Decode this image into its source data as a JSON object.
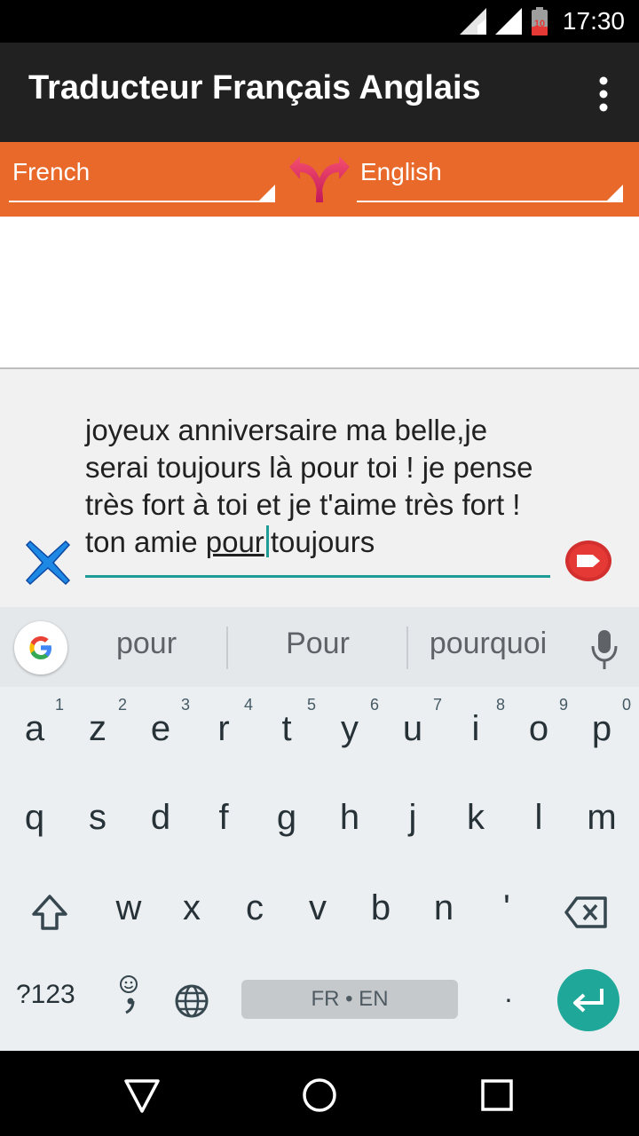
{
  "status_bar": {
    "time": "17:30",
    "battery_level": "10",
    "icons": [
      "signal-icon",
      "wifi-icon",
      "battery-icon"
    ]
  },
  "app_bar": {
    "title": "Traducteur Français Anglais",
    "overflow_icon": "more-vert-icon"
  },
  "language_bar": {
    "source_language": "French",
    "target_language": "English",
    "swap_icon": "swap-arrows-icon",
    "color": "#E8692A"
  },
  "input": {
    "text_before": "joyeux anniversaire ma belle,je serai toujours là pour toi ! je pense très fort à toi et je t'aime très fort ! ton amie ",
    "composing_word": "pour",
    "text_after": "toujours",
    "clear_icon": "clear-x-icon",
    "send_icon": "translate-send-icon",
    "accent_color": "#1E9C96"
  },
  "keyboard": {
    "suggestions": [
      "pour",
      "Pour",
      "pourquoi"
    ],
    "row1": [
      {
        "key": "a",
        "hint": "1"
      },
      {
        "key": "z",
        "hint": "2"
      },
      {
        "key": "e",
        "hint": "3"
      },
      {
        "key": "r",
        "hint": "4"
      },
      {
        "key": "t",
        "hint": "5"
      },
      {
        "key": "y",
        "hint": "6"
      },
      {
        "key": "u",
        "hint": "7"
      },
      {
        "key": "i",
        "hint": "8"
      },
      {
        "key": "o",
        "hint": "9"
      },
      {
        "key": "p",
        "hint": "0"
      }
    ],
    "row2": [
      "q",
      "s",
      "d",
      "f",
      "g",
      "h",
      "j",
      "k",
      "l",
      "m"
    ],
    "row3": [
      "w",
      "x",
      "c",
      "v",
      "b",
      "n",
      "'"
    ],
    "symbols_label": "?123",
    "space_label": "FR • EN",
    "period_label": ".",
    "enter_color": "#1FA89A"
  },
  "nav_bar": {
    "icons": [
      "back-icon",
      "home-icon",
      "recents-icon"
    ]
  }
}
